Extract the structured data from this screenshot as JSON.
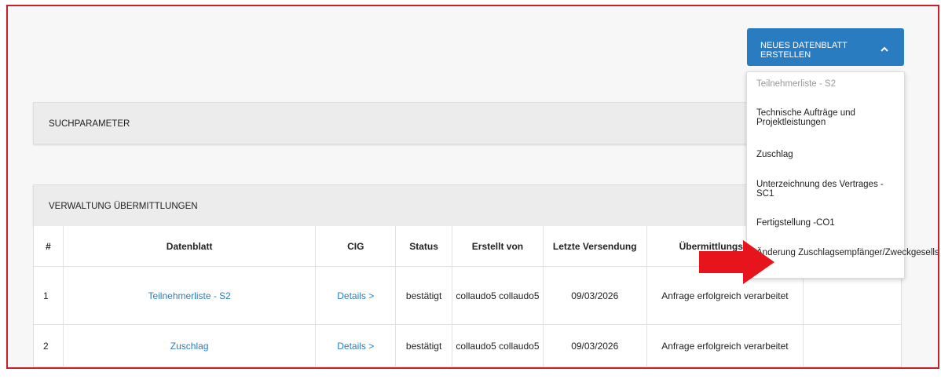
{
  "new_sheet_button": {
    "label": "NEUES DATENBLATT ERSTELLEN",
    "icon": "chevron-up-icon"
  },
  "dropdown": {
    "items": [
      {
        "label": "Teilnehmerliste - S2",
        "disabled": true
      },
      {
        "label": "Technische Aufträge und Projektleistungen",
        "disabled": false
      },
      {
        "label": "Zuschlag",
        "disabled": false
      },
      {
        "label": "Unterzeichnung des Vertrages - SC1",
        "disabled": false
      },
      {
        "label": "Fertigstellung -CO1",
        "disabled": false
      },
      {
        "label": "Änderung Zuschlagsempfänger/Zweckgesellschaft",
        "disabled": false
      }
    ]
  },
  "search_panel": {
    "title": "SUCHPARAMETER"
  },
  "submissions_panel": {
    "title": "VERWALTUNG ÜBERMITTLUNGEN"
  },
  "table": {
    "headers": [
      "#",
      "Datenblatt",
      "CIG",
      "Status",
      "Erstellt von",
      "Letzte Versendung",
      "Übermittlungsstatus",
      ""
    ],
    "rows": [
      {
        "num": "1",
        "datenblatt": "Teilnehmerliste - S2",
        "cig": "Details >",
        "status": "bestätigt",
        "erstellt_von": "collaudo5 collaudo5",
        "letzte_versendung": "09/03/2026",
        "uebermittlung": "Anfrage erfolgreich verarbeitet"
      },
      {
        "num": "2",
        "datenblatt": "Zuschlag",
        "cig": "Details >",
        "status": "bestätigt",
        "erstellt_von": "collaudo5 collaudo5",
        "letzte_versendung": "09/03/2026",
        "uebermittlung": "Anfrage erfolgreich verarbeitet"
      }
    ]
  },
  "colors": {
    "accent": "#2a7cc0",
    "frame_border": "#c8202a",
    "annotation_arrow": "#e8141b"
  }
}
